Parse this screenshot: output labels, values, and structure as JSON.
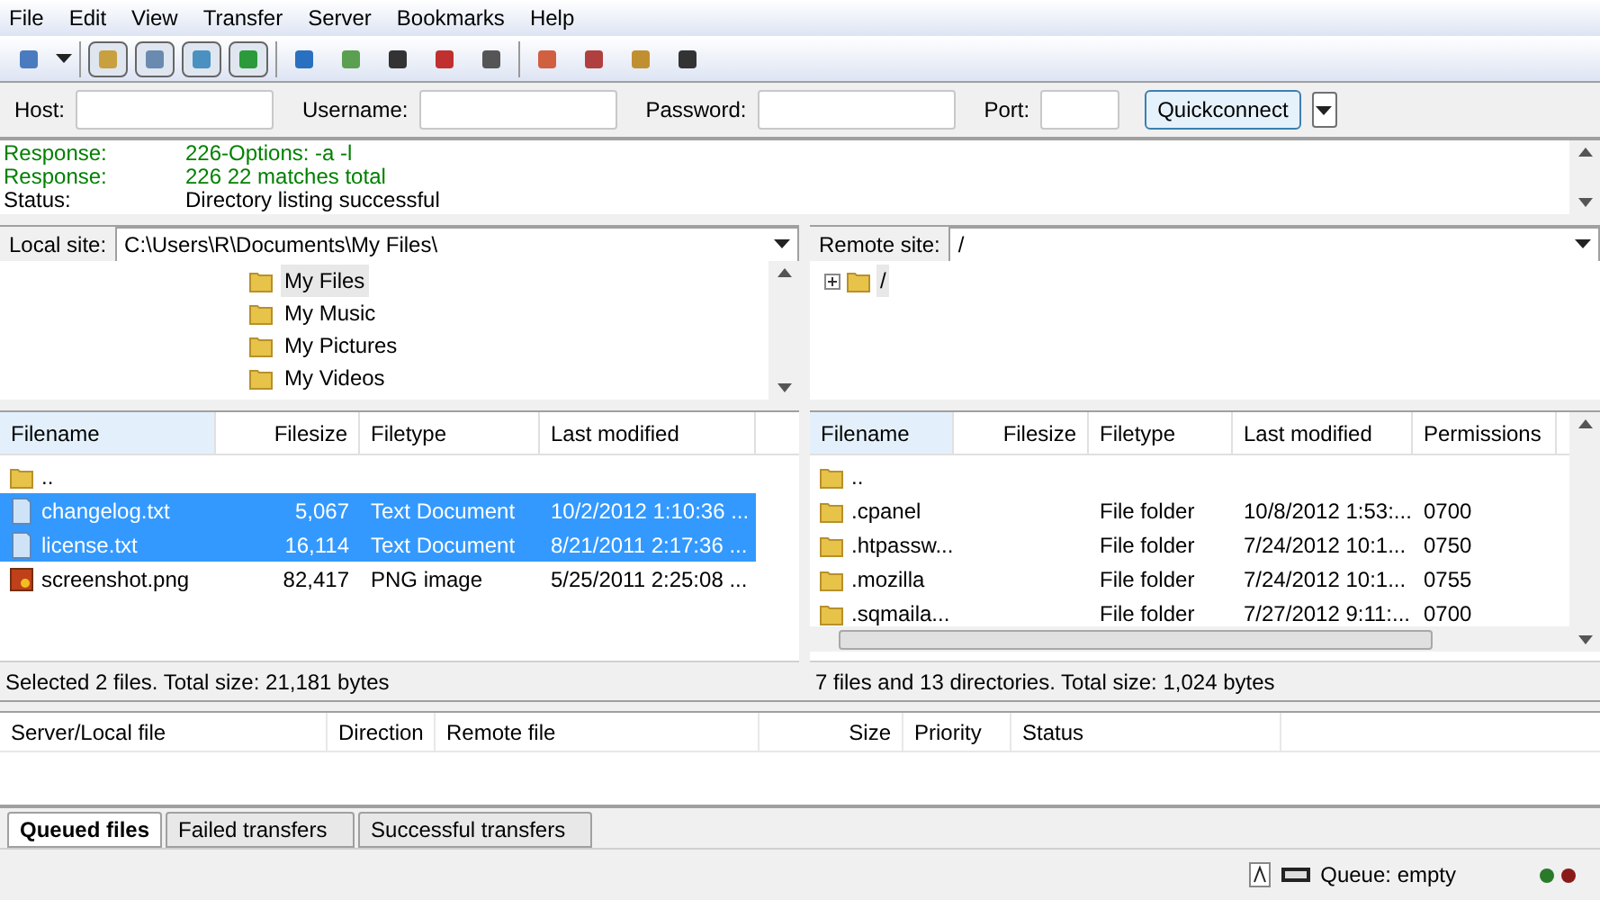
{
  "menu": [
    "File",
    "Edit",
    "View",
    "Transfer",
    "Server",
    "Bookmarks",
    "Help"
  ],
  "toolbar": [
    {
      "pressed": false
    },
    {
      "pressed": true
    },
    {
      "pressed": true
    },
    {
      "pressed": true
    },
    {
      "pressed": true
    },
    {
      "pressed": false
    },
    {
      "pressed": false
    },
    {
      "pressed": false
    },
    {
      "pressed": false
    },
    {
      "pressed": false
    },
    {
      "pressed": false
    },
    {
      "pressed": false
    },
    {
      "pressed": false
    },
    {
      "pressed": false
    }
  ],
  "quickconnect": {
    "fields": [
      {
        "label": "Host:"
      },
      {
        "label": "Username:"
      },
      {
        "label": "Password:"
      },
      {
        "label": "Port:"
      }
    ],
    "button": "Quickconnect"
  },
  "log": [
    {
      "kind": "response",
      "label": "Response:",
      "text": "226-Options: -a -l"
    },
    {
      "kind": "response",
      "label": "Response:",
      "text": "226 22 matches total"
    },
    {
      "kind": "status",
      "label": "Status:",
      "text": "Directory listing successful"
    }
  ],
  "local": {
    "site_label": "Local site:",
    "path": "C:\\Users\\R\\Documents\\My Files\\",
    "tree": [
      {
        "name": "My Files",
        "selected": true
      },
      {
        "name": "My Music",
        "selected": false
      },
      {
        "name": "My Pictures",
        "selected": false
      },
      {
        "name": "My Videos",
        "selected": false
      }
    ],
    "columns": [
      "Filename",
      "Filesize",
      "Filetype",
      "Last modified"
    ],
    "rows": [
      {
        "kind": "folder",
        "name": "..",
        "size": "",
        "type": "",
        "modified": "",
        "selected": false
      },
      {
        "kind": "text",
        "name": "changelog.txt",
        "size": "5,067",
        "type": "Text Document",
        "modified": "10/2/2012 1:10:36 ...",
        "selected": true
      },
      {
        "kind": "text",
        "name": "license.txt",
        "size": "16,114",
        "type": "Text Document",
        "modified": "8/21/2011 2:17:36 ...",
        "selected": true
      },
      {
        "kind": "image",
        "name": "screenshot.png",
        "size": "82,417",
        "type": "PNG image",
        "modified": "5/25/2011 2:25:08 ...",
        "selected": false
      }
    ],
    "status": "Selected 2 files. Total size: 21,181 bytes"
  },
  "remote": {
    "site_label": "Remote site:",
    "path": "/",
    "tree": [
      {
        "name": "/",
        "selected": true
      }
    ],
    "columns": [
      "Filename",
      "Filesize",
      "Filetype",
      "Last modified",
      "Permissions"
    ],
    "rows": [
      {
        "name": "..",
        "type": "",
        "modified": "",
        "perm": ""
      },
      {
        "name": ".cpanel",
        "type": "File folder",
        "modified": "10/8/2012 1:53:...",
        "perm": "0700"
      },
      {
        "name": ".htpassw...",
        "type": "File folder",
        "modified": "7/24/2012 10:1...",
        "perm": "0750"
      },
      {
        "name": ".mozilla",
        "type": "File folder",
        "modified": "7/24/2012 10:1...",
        "perm": "0755"
      },
      {
        "name": ".sqmaila...",
        "type": "File folder",
        "modified": "7/27/2012 9:11:...",
        "perm": "0700"
      }
    ],
    "status": "7 files and 13 directories. Total size: 1,024 bytes"
  },
  "queue": {
    "columns": [
      "Server/Local file",
      "Direction",
      "Remote file",
      "Size",
      "Priority",
      "Status"
    ],
    "tabs": [
      {
        "label": "Queued files",
        "selected": true
      },
      {
        "label": "Failed transfers",
        "selected": false
      },
      {
        "label": "Successful transfers",
        "selected": false
      }
    ],
    "status": "Queue: empty"
  }
}
